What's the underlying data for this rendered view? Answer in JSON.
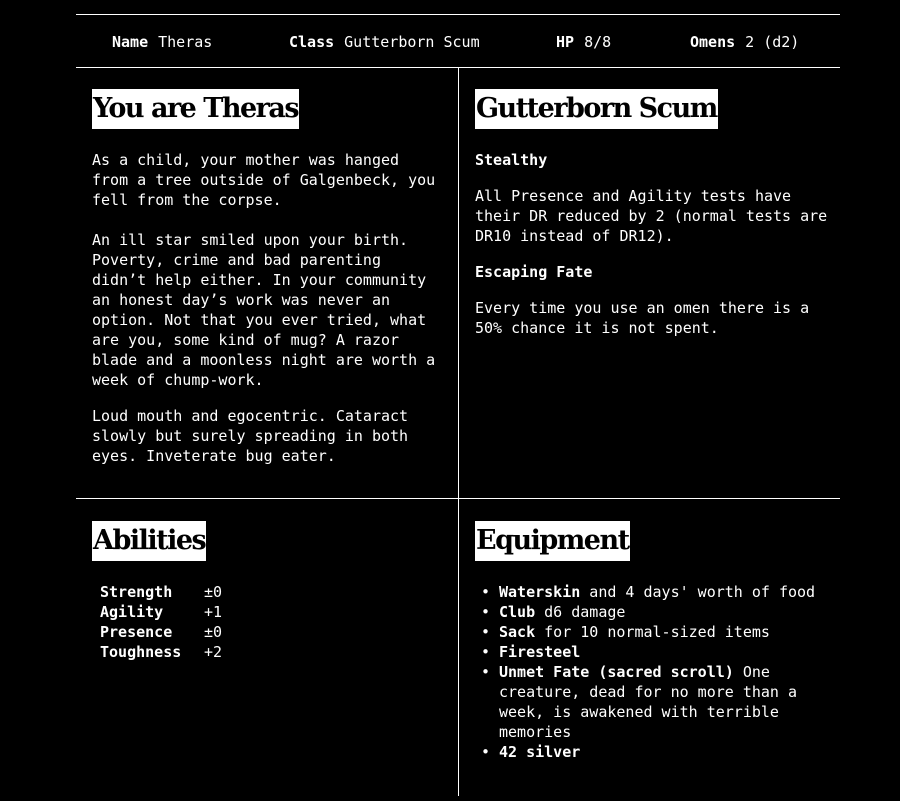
{
  "header": {
    "name_label": "Name",
    "name_value": "Theras",
    "class_label": "Class",
    "class_value": "Gutterborn Scum",
    "hp_label": "HP",
    "hp_value": "8/8",
    "omens_label": "Omens",
    "omens_value": "2 (d2)"
  },
  "bio": {
    "title": "You are Theras",
    "paragraphs": [
      "As a child, your mother was hanged from a tree outside of Galgenbeck, you fell from the corpse.",
      "An ill star smiled upon your birth. Poverty, crime and bad parenting didn’t help either. In your community an honest day’s work was never an option. Not that you ever tried, what are you, some kind of mug? A razor blade and a moonless night are worth a week of chump-work.",
      "Loud mouth and egocentric. Cataract slowly but surely spreading in both eyes. Inveterate bug eater."
    ]
  },
  "class_panel": {
    "title": "Gutterborn Scum",
    "abilities": [
      {
        "name": "Stealthy",
        "text": "All Presence and Agility tests have their DR reduced by 2 (normal tests are DR10 instead of DR12)."
      },
      {
        "name": "Escaping Fate",
        "text": "Every time you use an omen there is a 50% chance it is not spent."
      }
    ]
  },
  "abilities": {
    "title": "Abilities",
    "rows": [
      {
        "name": "Strength",
        "value": "±0"
      },
      {
        "name": "Agility",
        "value": "+1"
      },
      {
        "name": "Presence",
        "value": "±0"
      },
      {
        "name": "Toughness",
        "value": "+2"
      }
    ]
  },
  "equipment": {
    "title": "Equipment",
    "bullet": "•",
    "items": [
      {
        "name": "Waterskin",
        "desc": " and 4 days' worth of food"
      },
      {
        "name": "Club",
        "desc": " d6 damage"
      },
      {
        "name": "Sack",
        "desc": " for 10 normal-sized items"
      },
      {
        "name": "Firesteel",
        "desc": ""
      },
      {
        "name": "Unmet Fate (sacred scroll)",
        "desc": " One creature, dead for no more than a week, is awakened with terrible memories"
      },
      {
        "name": "42 silver",
        "desc": ""
      }
    ]
  },
  "colors": {
    "background": "#000000",
    "text": "#ffffff",
    "title_bg": "#ffffff",
    "title_text": "#000000"
  }
}
